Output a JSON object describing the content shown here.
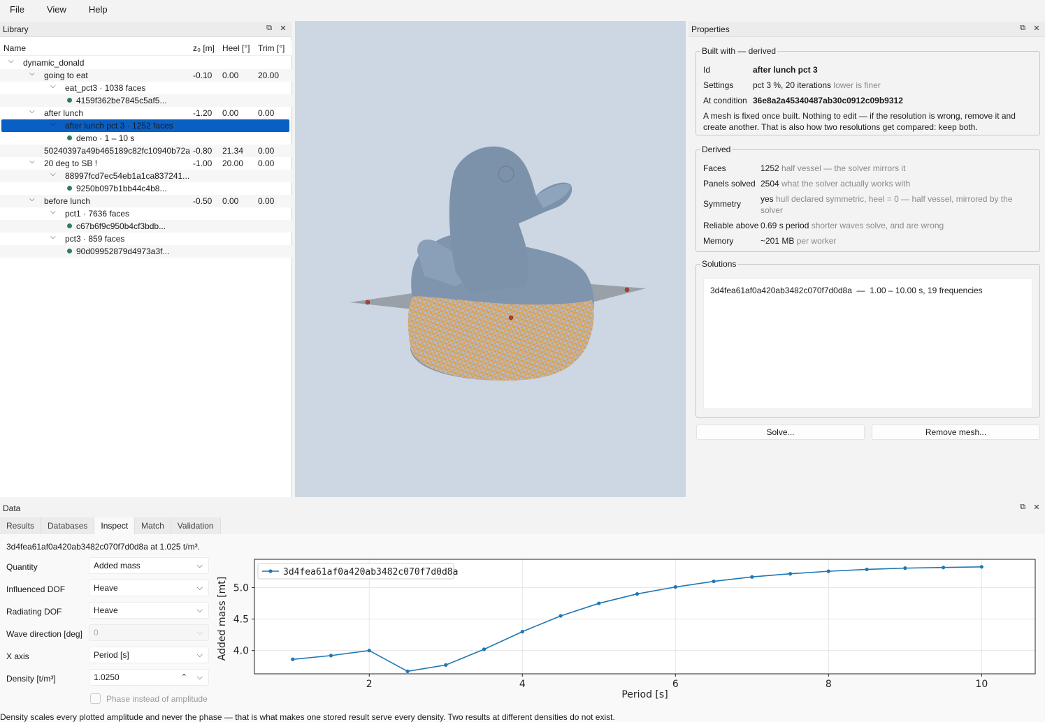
{
  "menu": [
    "File",
    "View",
    "Help"
  ],
  "library": {
    "title": "Library",
    "columns": [
      "Name",
      "z₀ [m]",
      "Heel [°]",
      "Trim [°]"
    ],
    "rows": [
      {
        "name": "dynamic_donald",
        "indent": 0,
        "chev": "v",
        "z0": "",
        "heel": "",
        "trim": ""
      },
      {
        "name": "going to eat",
        "indent": 1,
        "chev": "v",
        "z0": "-0.10",
        "heel": "0.00",
        "trim": "20.00"
      },
      {
        "name": "eat_pct3 · 1038 faces",
        "indent": 2,
        "chev": "v",
        "z0": "",
        "heel": "",
        "trim": ""
      },
      {
        "name": "4159f362be7845c5af5...",
        "indent": 3,
        "dot": true,
        "z0": "",
        "heel": "",
        "trim": ""
      },
      {
        "name": "after lunch",
        "indent": 1,
        "chev": "v",
        "z0": "-1.20",
        "heel": "0.00",
        "trim": "0.00"
      },
      {
        "name": "after lunch pct 3 · 1252 faces",
        "indent": 2,
        "chev": "v",
        "selected": true,
        "z0": "",
        "heel": "",
        "trim": ""
      },
      {
        "name": "demo · 1 – 10 s",
        "indent": 3,
        "dot": true,
        "z0": "",
        "heel": "",
        "trim": ""
      },
      {
        "name": "50240397a49b465189c82fc10940b72a",
        "indent": 1.6,
        "z0": "-0.80",
        "heel": "21.34",
        "trim": "0.00"
      },
      {
        "name": "20 deg to SB !",
        "indent": 1,
        "chev": "v",
        "z0": "-1.00",
        "heel": "20.00",
        "trim": "0.00"
      },
      {
        "name": "88997fcd7ec54eb1a1ca837241...",
        "indent": 2,
        "chev": "v",
        "z0": "",
        "heel": "",
        "trim": ""
      },
      {
        "name": "9250b097b1bb44c4b8...",
        "indent": 3,
        "dot": true,
        "z0": "",
        "heel": "",
        "trim": ""
      },
      {
        "name": "before lunch",
        "indent": 1,
        "chev": "v",
        "z0": "-0.50",
        "heel": "0.00",
        "trim": "0.00"
      },
      {
        "name": "pct1 · 7636 faces",
        "indent": 2,
        "chev": "v",
        "z0": "",
        "heel": "",
        "trim": ""
      },
      {
        "name": "c67b6f9c950b4cf3bdb...",
        "indent": 3,
        "dot": true,
        "z0": "",
        "heel": "",
        "trim": ""
      },
      {
        "name": "pct3 · 859 faces",
        "indent": 2,
        "chev": "v",
        "z0": "",
        "heel": "",
        "trim": ""
      },
      {
        "name": "90d09952879d4973a3f...",
        "indent": 3,
        "dot": true,
        "z0": "",
        "heel": "",
        "trim": ""
      }
    ]
  },
  "properties": {
    "title": "Properties",
    "built": {
      "title": "Built with — derived",
      "id_key": "Id",
      "id_val": "after lunch pct 3",
      "settings_key": "Settings",
      "settings_val": "pct 3 %, 20 iterations",
      "settings_note": "lower is finer",
      "cond_key": "At condition",
      "cond_val": "36e8a2a45340487ab30c0912c09b9312",
      "note1": "A mesh is fixed once built. Nothing to edit — if the resolution is wrong, remove it and",
      "note2": "create another. That is also how two resolutions get compared: keep both."
    },
    "derived": {
      "title": "Derived",
      "faces_key": "Faces",
      "faces_val": "1252",
      "faces_note": "half vessel — the solver mirrors it",
      "panels_key": "Panels solved",
      "panels_val": "2504",
      "panels_note": "what the solver actually works with",
      "sym_key": "Symmetry",
      "sym_val": "yes",
      "sym_note1": "hull declared symmetric, heel = 0 — half vessel, mirrored by the",
      "sym_note2": "solver",
      "rel_key": "Reliable above",
      "rel_val": "0.69 s period",
      "rel_note": "shorter waves solve, and are wrong",
      "mem_key": "Memory",
      "mem_val": "~201 MB",
      "mem_note": "per worker"
    },
    "solutions": {
      "title": "Solutions",
      "items": [
        "3d4fea61af0a420ab3482c070f7d0d8a  —  1.00 – 10.00 s, 19 frequencies"
      ]
    },
    "solve_label": "Solve...",
    "remove_label": "Remove mesh..."
  },
  "data_panel": {
    "title": "Data",
    "tabs": [
      "Results",
      "Databases",
      "Inspect",
      "Match",
      "Validation"
    ],
    "active_tab": "Inspect",
    "caption": "3d4fea61af0a420ab3482c070f7d0d8a at 1.025 t/m³.",
    "quantity_label": "Quantity",
    "quantity_value": "Added mass",
    "influenced_label": "Influenced DOF",
    "influenced_value": "Heave",
    "radiating_label": "Radiating DOF",
    "radiating_value": "Heave",
    "wave_label": "Wave direction [deg]",
    "wave_value": "0",
    "xaxis_label": "X axis",
    "xaxis_value": "Period [s]",
    "density_label": "Density [t/m³]",
    "density_value": "1.0250",
    "phase_label": "Phase instead of amplitude",
    "footer": "Density scales every plotted amplitude and never the phase — that is what makes one stored result serve every density. Two results at different densities do not exist."
  },
  "colors": {
    "accent": "#0a5fc4",
    "series": "#1f77b4",
    "mesh": "#e8961c",
    "hull": "#7f95ad",
    "dot": "#2e7d5b"
  },
  "chart_data": {
    "type": "line",
    "xlabel": "Period [s]",
    "ylabel": "Added mass [mt]",
    "xlim": [
      0.5,
      10.7
    ],
    "ylim": [
      3.63,
      5.45
    ],
    "xticks": [
      2,
      4,
      6,
      8,
      10
    ],
    "yticks": [
      4.0,
      4.5,
      5.0
    ],
    "grid": true,
    "legend": "top-left",
    "series": [
      {
        "name": "3d4fea61af0a420ab3482c070f7d0d8a",
        "x": [
          1.0,
          1.5,
          2.0,
          2.5,
          3.0,
          3.5,
          4.0,
          4.5,
          5.0,
          5.5,
          6.0,
          6.5,
          7.0,
          7.5,
          8.0,
          8.5,
          9.0,
          9.5,
          10.0
        ],
        "y": [
          3.86,
          3.92,
          4.0,
          3.67,
          3.77,
          4.02,
          4.3,
          4.55,
          4.75,
          4.9,
          5.01,
          5.1,
          5.17,
          5.22,
          5.26,
          5.29,
          5.31,
          5.32,
          5.33
        ]
      }
    ]
  }
}
